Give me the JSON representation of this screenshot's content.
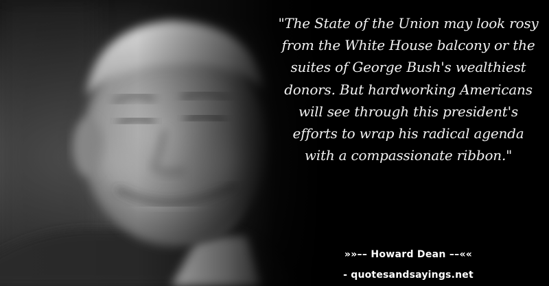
{
  "quote": {
    "text": "\"The State of the Union may look rosy from the White House balcony or the suites of George Bush's wealthiest donors. But hardworking Americans will see through this president's efforts to wrap his radical agenda with a compassionate ribbon.\""
  },
  "attribution": {
    "author": "»»–– Howard Dean ––««",
    "site": "- quotesandsayings.net"
  },
  "colors": {
    "background": "#000000",
    "text": "#ffffff"
  }
}
